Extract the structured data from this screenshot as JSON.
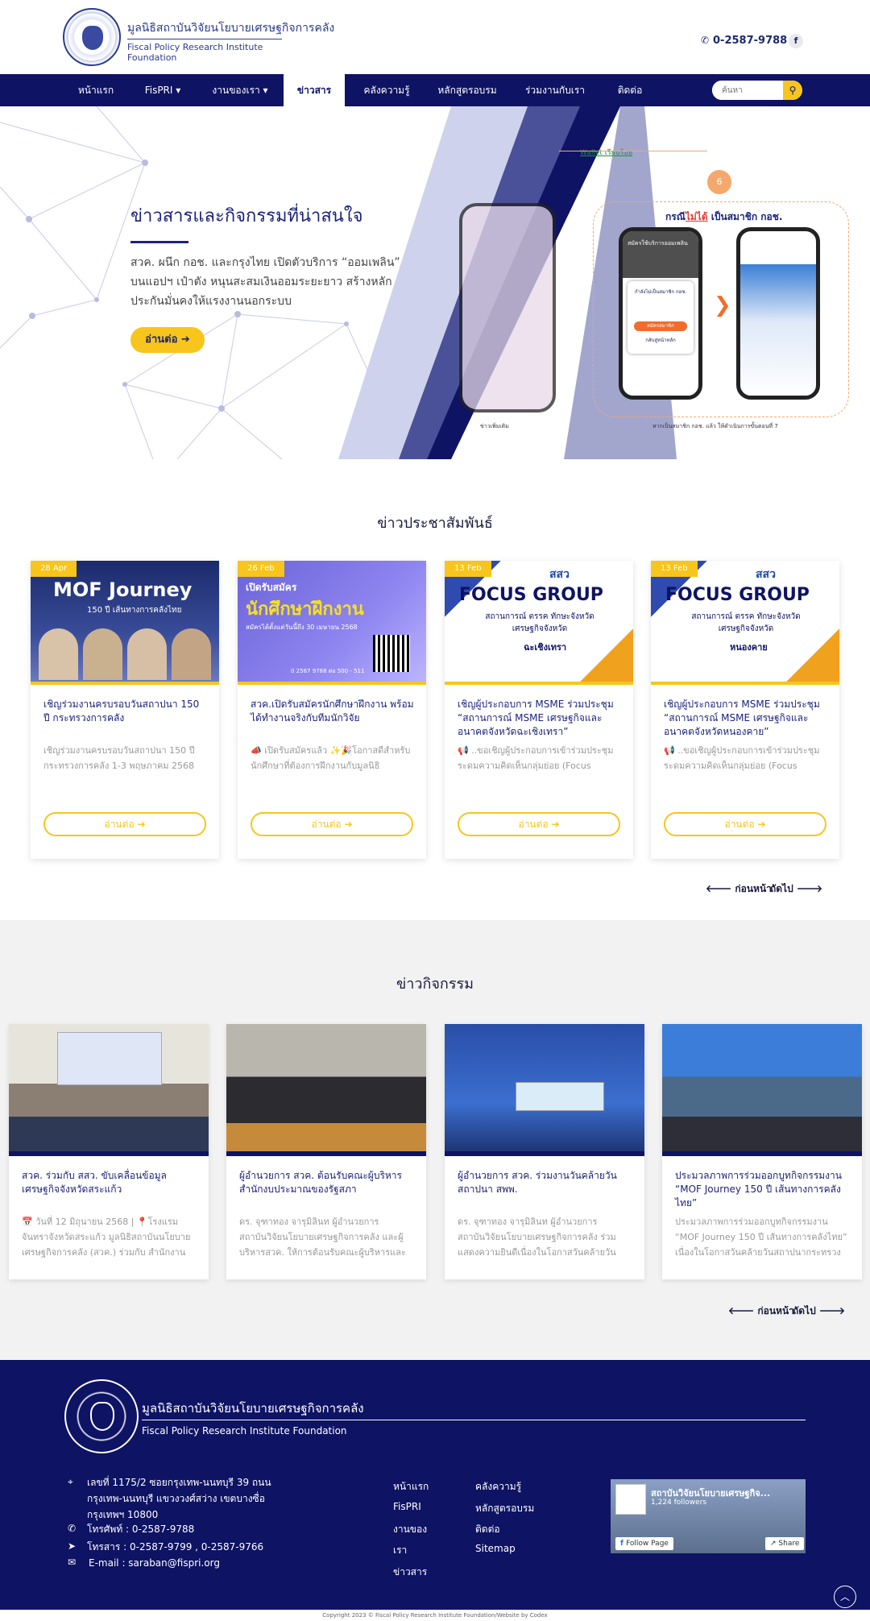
{
  "header": {
    "org_th": "มูลนิธิสถาบันวิจัยนโยบายเศรษฐกิจการคลัง",
    "org_en": "Fiscal Policy Research Institute Foundation",
    "phone": "0-2587-9788",
    "facebook_icon": "f"
  },
  "nav": {
    "items": [
      {
        "label": "หน้าแรก"
      },
      {
        "label": "FisPRI ▾"
      },
      {
        "label": "งานของเรา ▾"
      },
      {
        "label": "ข่าวสาร"
      },
      {
        "label": "คลังความรู้"
      },
      {
        "label": "หลักสูตรอบรม"
      },
      {
        "label": "ร่วมงานกับเรา"
      },
      {
        "label": "ติดต่อ"
      }
    ],
    "search_placeholder": "ค้นหา",
    "search_icon": "⚲"
  },
  "hero": {
    "title": "ข่าวสารและกิจกรรมที่น่าสนใจ",
    "desc": "สวค. ผนึก กอช. และกรุงไทย เปิดตัวบริการ “ออมเพลิน” บนแอปฯ เป๋าตัง หนุนสะสมเงินออมระยะยาว สร้างหลักประกันมั่นคงให้แรงงานนอกระบบ",
    "button": "อ่านต่อ ➔",
    "img_link": "Wallet เรียบร้อย",
    "img_step": "6",
    "img_heading_a": "กรณี",
    "img_heading_b": "ไม่ได้",
    "img_heading_c": " เป็นสมาชิก กอช.",
    "img_caption_left": "ข่าวเพิ่มเติม",
    "img_caption_right": "หากเป็นสมาชิก กอช. แล้ว ให้ดำเนินการขั้นตอนที่ 7",
    "phone_a_title": "สมัครใช้บริการออมเพลิน",
    "phone_a_box": "กำลังไม่เป็นสมาชิก กอช.",
    "phone_a_btn": "สมัครสมาชิก",
    "phone_a_btn2": "กลับสู่หน้าหลัก"
  },
  "pr": {
    "section_title": "ข่าวประชาสัมพันธ์",
    "read_more": "อ่านต่อ ➔",
    "cards": [
      {
        "date": "28 Apr",
        "img_title": "MOF Journey",
        "img_sub": "150 ปี เส้นทางการคลังไทย",
        "title": "เชิญร่วมงานครบรอบวันสถาปนา 150 ปี กระทรวงการคลัง",
        "excerpt": "เชิญร่วมงานครบรอบวันสถาปนา 150 ปี กระทรวงการคลัง 1-3 พฤษภาคม 2568"
      },
      {
        "date": "26 Feb",
        "img_title": "นักศึกษาฝึกงาน",
        "img_sub": "เปิดรับสมัคร",
        "img_sub2": "สมัครได้ตั้งแต่วันนี้ถึง 30 เมษายน 2568",
        "img_phone": "0 2587 9788 ต่อ 500 - 511",
        "title": "สวค.เปิดรับสมัครนักศึกษาฝึกงาน พร้อมได้ทำงานจริงกับทีมนักวิจัย",
        "excerpt": "📣 เปิดรับสมัครแล้ว ✨🎉โอกาสดีสำหรับนักศึกษาที่ต้องการฝึกงานกับมูลนิธิ"
      },
      {
        "date": "13 Feb",
        "img_title": "FOCUS GROUP",
        "img_brand": "สสว",
        "img_sub": "สถานการณ์ ตรรค ทักษะจังหวัด เศรษฐกิจจังหวัด",
        "img_place": "ฉะเชิงเทรา",
        "title": "เชิญผู้ประกอบการ MSME ร่วมประชุม “สถานการณ์ MSME เศรษฐกิจและอนาคตจังหวัดฉะเชิงเทรา”",
        "excerpt": "📢 ..ขอเชิญผู้ประกอบการเข้าร่วมประชุมระดมความคิดเห็นกลุ่มย่อย (Focus"
      },
      {
        "date": "13 Feb",
        "img_title": "FOCUS GROUP",
        "img_brand": "สสว",
        "img_sub": "สถานการณ์ ตรรค ทักษะจังหวัด เศรษฐกิจจังหวัด",
        "img_place": "หนองคาย",
        "title": "เชิญผู้ประกอบการ MSME ร่วมประชุม “สถานการณ์ MSME เศรษฐกิจและอนาคตจังหวัดหนองคาย”",
        "excerpt": "📢 ..ขอเชิญผู้ประกอบการเข้าร่วมประชุมระดมความคิดเห็นกลุ่มย่อย (Focus"
      }
    ],
    "prev": "🡐 ก่อนหน้า",
    "next": "ถัดไป 🡒"
  },
  "activities": {
    "section_title": "ข่าวกิจกรรม",
    "cards": [
      {
        "title": "สวค. ร่วมกับ สสว. ขับเคลื่อนข้อมูลเศรษฐกิจจังหวัดสระแก้ว",
        "excerpt": "📅 วันที่ 12 มิถุนายน 2568 | 📍โรงแรมจันทราจังหวัดสระแก้ว มูลนิธิสถาบันนโยบายเศรษฐกิจการคลัง (สวค.) ร่วมกับ สำนักงาน"
      },
      {
        "title": "ผู้อำนวยการ สวค. ต้อนรับคณะผู้บริหารสำนักงบประมาณของรัฐสภา",
        "excerpt": "ดร. จุฑาทอง จารุมิลินท ผู้อำนวยการสถาบันวิจัยนโยบายเศรษฐกิจการคลัง และผู้บริหารสวค. ให้การต้อนรับคณะผู้บริหารและ"
      },
      {
        "title": "ผู้อำนวยการ สวค. ร่วมงานวันคล้ายวันสถาปนา สพพ.",
        "excerpt": "ดร. จุฑาทอง จารุมิลินท ผู้อำนวยการสถาบันวิจัยนโยบายเศรษฐกิจการคลัง ร่วมแสดงความยินดีเนื่องในโอกาสวันคล้ายวัน"
      },
      {
        "title": "ประมวลภาพการร่วมออกบูทกิจกรรมงาน “MOF Journey 150 ปี เส้นทางการคลังไทย”",
        "excerpt": "ประมวลภาพการร่วมออกบูทกิจกรรมงาน “MOF Journey 150 ปี เส้นทางการคลังไทย” เนื่องในโอกาสวันคล้ายวันสถาปนากระทรวง"
      }
    ],
    "prev": "🡐 ก่อนหน้า",
    "next": "ถัดไป 🡒"
  },
  "footer": {
    "org_th": "มูลนิธิสถาบันวิจัยนโยบายเศรษฐกิจการคลัง",
    "org_en": "Fiscal Policy Research Institute Foundation",
    "address": "เลขที่ 1175/2 ซอยกรุงเทพ-นนทบุรี 39 ถนนกรุงเทพ-นนทบุรี แขวงวงศ์สว่าง เขตบางซื่อ กรุงเทพฯ 10800",
    "phone": "โทรศัพท์ : 0-2587-9788",
    "fax": "โทรสาร : 0-2587-9799 , 0-2587-9766",
    "email": "E-mail : saraban@fispri.org",
    "links_col1": [
      "หน้าแรก",
      "FisPRI",
      "งานของ",
      "เรา",
      "ข่าวสาร"
    ],
    "links_col2": [
      "คลังความรู้",
      "หลักสูตรอบรม",
      "ติดต่อ",
      "Sitemap"
    ],
    "fb_page_name": "สถาบันวิจัยนโยบายเศรษฐกิจ...",
    "fb_followers": "1,224 followers",
    "fb_follow": "Follow Page",
    "fb_share": "Share",
    "to_top": "︿"
  },
  "copyright": "Copyright 2023 © Fiscal Policy Research Institute Foundation/Website by Codex"
}
